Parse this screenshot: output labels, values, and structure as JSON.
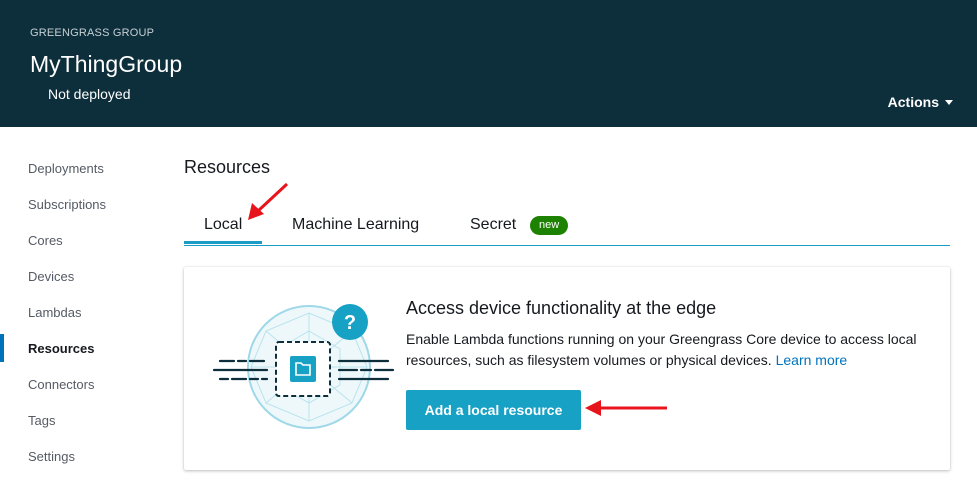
{
  "header": {
    "eyebrow": "GREENGRASS GROUP",
    "title": "MyThingGroup",
    "status": "Not deployed",
    "actions_label": "Actions"
  },
  "sidebar": {
    "items": [
      {
        "label": "Deployments"
      },
      {
        "label": "Subscriptions"
      },
      {
        "label": "Cores"
      },
      {
        "label": "Devices"
      },
      {
        "label": "Lambdas"
      },
      {
        "label": "Resources",
        "active": true
      },
      {
        "label": "Connectors"
      },
      {
        "label": "Tags"
      },
      {
        "label": "Settings"
      }
    ]
  },
  "main": {
    "section_title": "Resources",
    "tabs": [
      {
        "label": "Local",
        "active": true
      },
      {
        "label": "Machine Learning"
      },
      {
        "label": "Secret",
        "badge": "new"
      }
    ],
    "card": {
      "illustration_icon": "folder-icon",
      "help_badge": "?",
      "heading": "Access device functionality at the edge",
      "description": "Enable Lambda functions running on your Greengrass Core device to access local resources, such as filesystem volumes or physical devices.",
      "learn_more": "Learn more",
      "button_label": "Add a local resource"
    }
  },
  "colors": {
    "header_bg": "#0d2e3b",
    "accent": "#16a1c5",
    "tab_underline": "#1a9cc4",
    "badge_green": "#1d8102",
    "link": "#0073bb",
    "annotation_arrow": "#e8141b"
  }
}
